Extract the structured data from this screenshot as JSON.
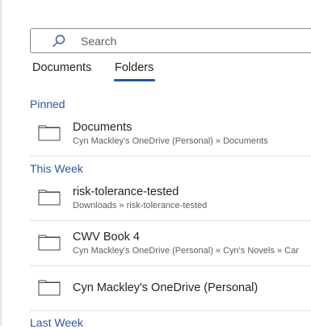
{
  "search": {
    "placeholder": "Search",
    "value": ""
  },
  "tabs": [
    {
      "label": "Documents",
      "selected": false
    },
    {
      "label": "Folders",
      "selected": true
    }
  ],
  "sections": {
    "pinned": "Pinned",
    "this_week": "This Week",
    "last_week": "Last Week"
  },
  "folders": [
    {
      "name": "Documents",
      "path": "Cyn Mackley's OneDrive (Personal) » Documents"
    },
    {
      "name": "risk-tolerance-tested",
      "path": "Downloads » risk-tolerance-tested"
    },
    {
      "name": "CWV Book 4",
      "path": "Cyn Mackley's OneDrive (Personal) » Cyn's Novels » Car"
    },
    {
      "name": "Cyn Mackley's OneDrive (Personal)",
      "path": ""
    }
  ],
  "colors": {
    "accent": "#2b579a",
    "separator": "#e1dfdd",
    "secondary_text": "#605e5c"
  }
}
